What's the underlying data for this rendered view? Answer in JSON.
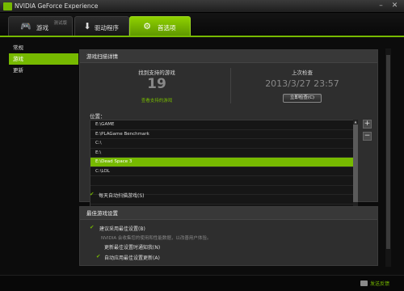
{
  "window": {
    "title": "NVIDIA GeForce Experience",
    "min": "–",
    "close": "✕"
  },
  "tabs": [
    {
      "label": "游戏",
      "sub": "测试版",
      "icon": "gamepad-icon",
      "glyph": "🎮",
      "active": false
    },
    {
      "label": "驱动程序",
      "icon": "download-arrow-icon",
      "glyph": "⬇",
      "active": false
    },
    {
      "label": "首选项",
      "icon": "gears-icon",
      "glyph": "⚙",
      "active": true
    }
  ],
  "sidebar": {
    "items": [
      {
        "label": "常规",
        "active": false
      },
      {
        "label": "游戏",
        "active": true
      },
      {
        "label": "更新",
        "active": false
      }
    ]
  },
  "scan": {
    "header": "游戏扫描详情",
    "found_label": "找到支持的游戏",
    "found_count": "19",
    "view_link": "查看支持的游戏",
    "last_check_label": "上次检查",
    "last_check_date": "2013/3/27 23:57",
    "scan_now_button": "立即检查(C)",
    "locations_label": "位置：",
    "locations": [
      {
        "path": "E:\\GAME",
        "selected": false
      },
      {
        "path": "E:\\PLAGame Benchmark",
        "selected": false
      },
      {
        "path": "C:\\",
        "selected": false
      },
      {
        "path": "E:\\",
        "selected": false
      },
      {
        "path": "E:\\Dead Space 3",
        "selected": true
      },
      {
        "path": "C:\\LOL",
        "selected": false
      },
      {
        "path": "",
        "selected": false
      },
      {
        "path": "",
        "selected": false
      },
      {
        "path": "",
        "selected": false
      },
      {
        "path": "",
        "selected": false
      },
      {
        "path": "",
        "selected": false
      }
    ],
    "add_button": "+",
    "remove_button": "−",
    "daily_scan_label": "每天自动扫描游戏(S)"
  },
  "optimal": {
    "header": "最佳游戏设置",
    "recommend_label": "建议采用最佳设置(B)",
    "recommend_desc": "NVIDIA 会收集您的使用和性能数据，以改善用户体验。",
    "notify_label": "更新最佳设置时通知我(N)",
    "auto_apply_label": "自动应用最佳设置更新(A)"
  },
  "footer": {
    "feedback": "发送反馈"
  },
  "colors": {
    "accent": "#76b900"
  }
}
